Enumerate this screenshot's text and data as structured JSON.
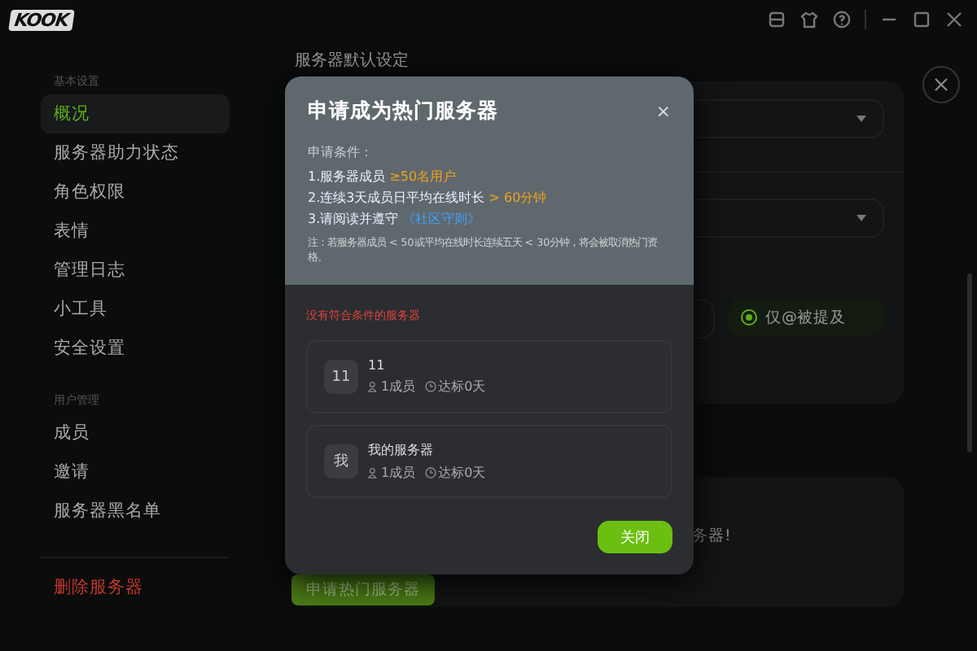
{
  "app": {
    "logo": "KOOK"
  },
  "sidebar": {
    "sections": [
      {
        "title": "基本设置",
        "items": [
          {
            "label": "概况",
            "selected": true
          },
          {
            "label": "服务器助力状态",
            "selected": false
          },
          {
            "label": "角色权限",
            "selected": false
          },
          {
            "label": "表情",
            "selected": false
          },
          {
            "label": "管理日志",
            "selected": false
          },
          {
            "label": "小工具",
            "selected": false
          },
          {
            "label": "安全设置",
            "selected": false
          }
        ]
      },
      {
        "title": "用户管理",
        "items": [
          {
            "label": "成员",
            "selected": false
          },
          {
            "label": "邀请",
            "selected": false
          },
          {
            "label": "服务器黑名单",
            "selected": false
          }
        ]
      }
    ],
    "danger_item": "删除服务器"
  },
  "main": {
    "title": "服务器默认设定",
    "radio": {
      "label": "仅@被提及",
      "selected": true
    },
    "partial_text": "务器!",
    "apply_button": "申请热门服务器"
  },
  "dialog": {
    "title": "申请成为热门服务器",
    "close": "×",
    "conditions_label": "申请条件：",
    "conditions": [
      {
        "text": "1.服务器成员",
        "highlight": "≥50名用户",
        "kind": "value"
      },
      {
        "text": "2.连续3天成员日平均在线时长",
        "highlight": "> 60分钟",
        "kind": "value"
      },
      {
        "text": "3.请阅读并遵守",
        "highlight": "《社区守则》",
        "kind": "link"
      }
    ],
    "note": "注：若服务器成员 < 50或平均在线时长连续五天 < 30分钟，将会被取消热门资格。",
    "empty_notice": "没有符合条件的服务器",
    "servers": [
      {
        "avatar": "11",
        "name": "11",
        "members": "1成员",
        "days": "达标0天"
      },
      {
        "avatar": "我",
        "name": "我的服务器",
        "members": "1成员",
        "days": "达标0天"
      }
    ],
    "button": "关闭"
  }
}
